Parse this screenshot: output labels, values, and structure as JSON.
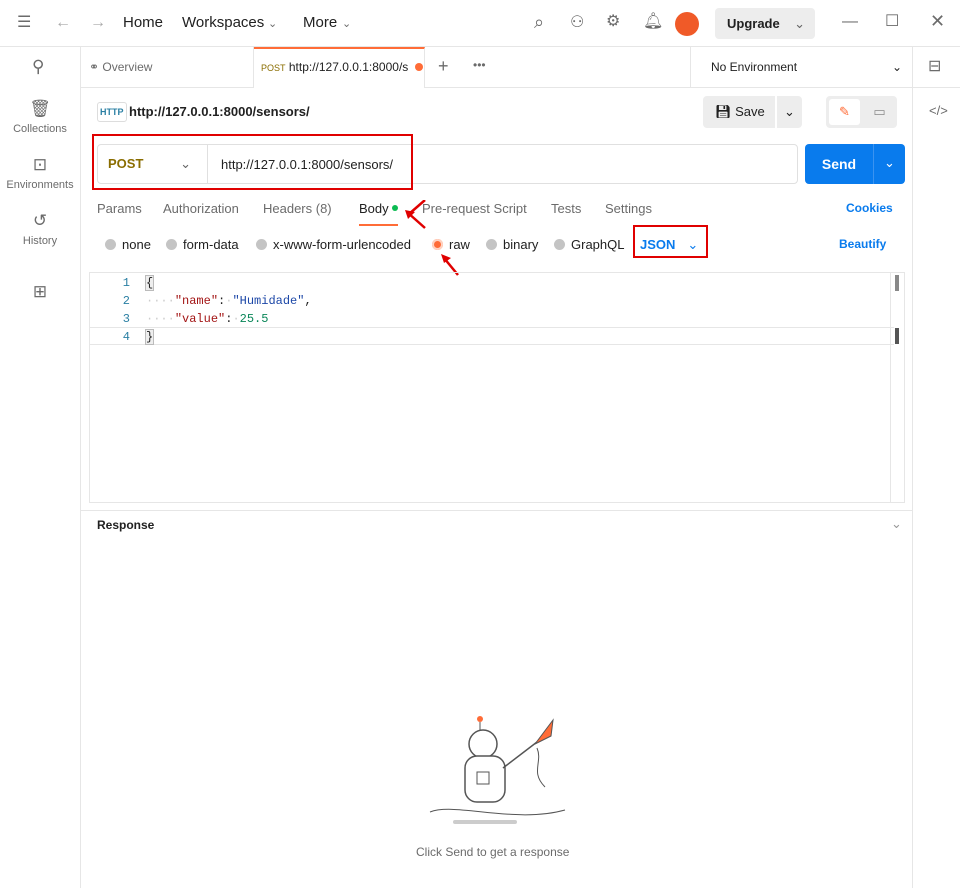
{
  "topbar": {
    "home": "Home",
    "workspaces": "Workspaces",
    "more": "More",
    "upgrade": "Upgrade"
  },
  "sidebar": {
    "items": [
      {
        "label": "Collections"
      },
      {
        "label": "Environments"
      },
      {
        "label": "History"
      }
    ]
  },
  "tabs": {
    "overview": "Overview",
    "active_method": "POST",
    "active_url": "http://127.0.0.1:8000/s",
    "environment": "No Environment"
  },
  "request": {
    "title": "http://127.0.0.1:8000/sensors/",
    "save": "Save",
    "method": "POST",
    "url": "http://127.0.0.1:8000/sensors/",
    "send": "Send"
  },
  "req_tabs": {
    "params": "Params",
    "authorization": "Authorization",
    "headers": "Headers (8)",
    "body": "Body",
    "prerequest": "Pre-request Script",
    "tests": "Tests",
    "settings": "Settings",
    "cookies": "Cookies"
  },
  "body_types": {
    "none": "none",
    "form_data": "form-data",
    "urlencoded": "x-www-form-urlencoded",
    "raw": "raw",
    "binary": "binary",
    "graphql": "GraphQL",
    "format": "JSON",
    "beautify": "Beautify"
  },
  "editor": {
    "lines": [
      "1",
      "2",
      "3",
      "4"
    ],
    "open": "{",
    "key1": "\"name\"",
    "val1": "\"Humidade\"",
    "key2": "\"value\"",
    "val2": "25.5",
    "close": "}"
  },
  "response": {
    "title": "Response",
    "empty": "Click Send to get a response"
  }
}
